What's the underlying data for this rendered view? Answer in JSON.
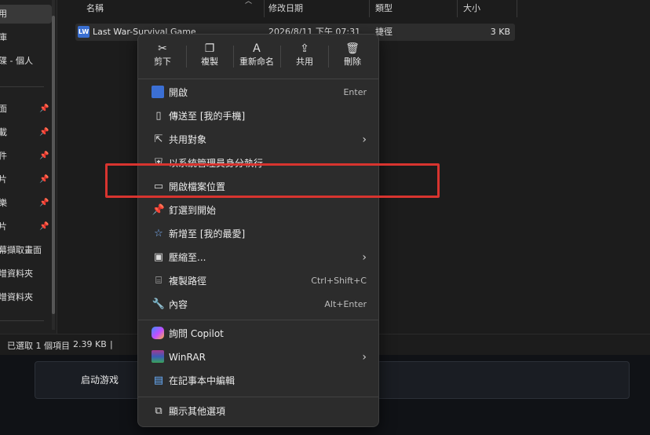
{
  "nav": {
    "items": [
      {
        "label": "用",
        "pinned": false,
        "selected": true
      },
      {
        "label": "庫",
        "pinned": false
      },
      {
        "label": "碟 - 個人",
        "pinned": false
      },
      {
        "label": "面",
        "pinned": true
      },
      {
        "label": "載",
        "pinned": true
      },
      {
        "label": "件",
        "pinned": true
      },
      {
        "label": "片",
        "pinned": true
      },
      {
        "label": "樂",
        "pinned": true
      },
      {
        "label": "片",
        "pinned": true
      },
      {
        "label": "幕擷取畫面",
        "pinned": false
      },
      {
        "label": "增資料夾",
        "pinned": false
      },
      {
        "label": "增資料夾",
        "pinned": false
      }
    ],
    "pin_glyph": "📌"
  },
  "columns": {
    "name": "名稱",
    "modified": "修改日期",
    "type": "類型",
    "size": "大小"
  },
  "file": {
    "name": "Last War-Survival Game",
    "modified": "2026/8/11 下午 07:31",
    "type": "捷徑",
    "size": "3 KB"
  },
  "status": {
    "selected": "已選取 1 個項目",
    "size": "2.39 KB"
  },
  "launcher": {
    "button_label": "启动游戏"
  },
  "context_menu": {
    "quick_actions": [
      {
        "label": "剪下",
        "icon": "scissors-icon",
        "glyph": "✂"
      },
      {
        "label": "複製",
        "icon": "copy-icon",
        "glyph": "❐"
      },
      {
        "label": "重新命名",
        "icon": "rename-icon",
        "glyph": "Ａ"
      },
      {
        "label": "共用",
        "icon": "share-icon",
        "glyph": "⇪"
      },
      {
        "label": "刪除",
        "icon": "trash-icon",
        "glyph": "🗑"
      }
    ],
    "items": [
      {
        "label": "開啟",
        "shortcut": "Enter",
        "icon": "app-icon",
        "glyph": ""
      },
      {
        "label": "傳送至 [我的手機]",
        "icon": "phone-icon",
        "glyph": "▯"
      },
      {
        "label": "共用對象",
        "icon": "share-with-icon",
        "glyph": "⇱",
        "submenu": true
      },
      {
        "label": "以系統管理員身分執行",
        "icon": "shield-icon",
        "glyph": "⛨"
      },
      {
        "label": "開啟檔案位置",
        "icon": "folder-icon",
        "glyph": "▭"
      },
      {
        "label": "釘選到開始",
        "icon": "pin-icon",
        "glyph": "📌"
      },
      {
        "label": "新增至 [我的最愛]",
        "icon": "star-icon",
        "glyph": "☆"
      },
      {
        "label": "壓縮至...",
        "icon": "zip-icon",
        "glyph": "▣",
        "submenu": true
      },
      {
        "label": "複製路徑",
        "shortcut": "Ctrl+Shift+C",
        "icon": "path-icon",
        "glyph": "⌸"
      },
      {
        "label": "內容",
        "shortcut": "Alt+Enter",
        "icon": "wrench-icon",
        "glyph": "🔧"
      },
      {
        "label": "詢問 Copilot",
        "icon": "copilot-icon",
        "glyph": ""
      },
      {
        "label": "WinRAR",
        "icon": "winrar-icon",
        "glyph": "",
        "submenu": true
      },
      {
        "label": "在記事本中編輯",
        "icon": "notepad-icon",
        "glyph": "▤"
      },
      {
        "label": "顯示其他選項",
        "icon": "more-options-icon",
        "glyph": "⧉"
      }
    ],
    "submenu_glyph": "›"
  },
  "colors": {
    "highlight": "#d8342f",
    "menu_bg": "#2c2c2c"
  }
}
